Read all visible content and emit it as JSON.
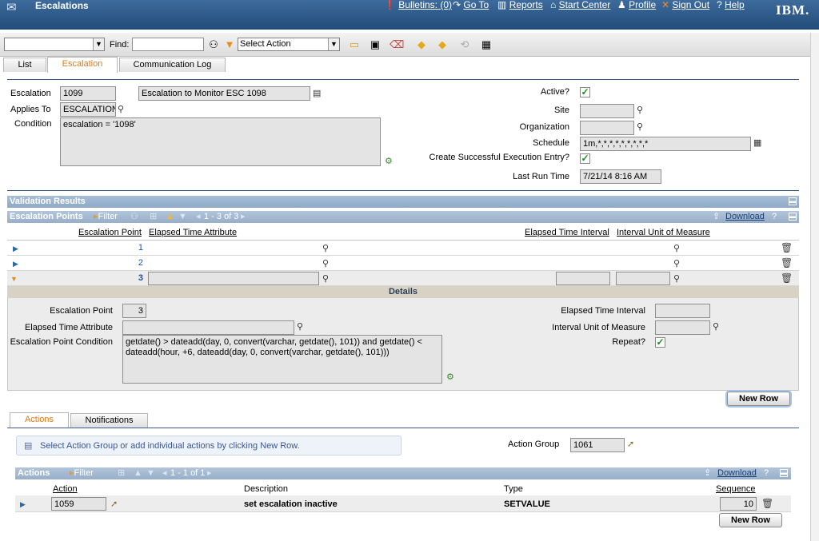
{
  "app": {
    "title": "Escalations",
    "nav": {
      "bulletins": "Bulletins: (0)",
      "goto": "Go To",
      "reports": "Reports",
      "start_center": "Start Center",
      "profile": "Profile",
      "sign_out": "Sign Out",
      "help": "Help"
    },
    "brand": "IBM."
  },
  "toolbar": {
    "find_label": "Find:",
    "find_value": "",
    "query_value": "",
    "select_action": "Select Action"
  },
  "tabs": [
    "List",
    "Escalation",
    "Communication Log"
  ],
  "header": {
    "escalation_label": "Escalation",
    "escalation_value": "1099",
    "escalation_desc": "Escalation to Monitor ESC 1098",
    "applies_to_label": "Applies To",
    "applies_to_value": "ESCALATION",
    "condition_label": "Condition",
    "condition_value": "escalation = '1098'",
    "active_label": "Active?",
    "site_label": "Site",
    "organization_label": "Organization",
    "schedule_label": "Schedule",
    "schedule_value": "1m,*,*,*,*,*,*,*,*,*",
    "create_entry_label": "Create Successful Execution Entry?",
    "last_run_label": "Last Run Time",
    "last_run_value": "7/21/14 8:16 AM"
  },
  "validation": {
    "title": "Validation Results"
  },
  "escalation_points": {
    "title": "Escalation Points",
    "filter": "Filter",
    "paging": "1 - 3 of 3",
    "download": "Download",
    "help": "?",
    "columns": [
      "Escalation Point",
      "Elapsed Time Attribute",
      "Elapsed Time Interval",
      "Interval Unit of Measure"
    ],
    "rows": [
      "1",
      "2",
      "3"
    ]
  },
  "details": {
    "title": "Details",
    "point_label": "Escalation Point",
    "point_value": "3",
    "elapsed_attr_label": "Elapsed Time Attribute",
    "condition_label": "Escalation Point Condition",
    "condition_value": "getdate() > dateadd(day, 0, convert(varchar, getdate(), 101)) and getdate() < dateadd(hour, +6, dateadd(day, 0, convert(varchar, getdate(), 101)))",
    "elapsed_interval_label": "Elapsed Time Interval",
    "interval_uom_label": "Interval Unit of Measure",
    "repeat_label": "Repeat?",
    "new_row": "New Row"
  },
  "subtabs": [
    "Actions",
    "Notifications"
  ],
  "actions_panel": {
    "hint": "Select Action Group or add individual actions by clicking New Row.",
    "group_label": "Action Group",
    "group_value": "1061"
  },
  "actions_table": {
    "title": "Actions",
    "filter": "Filter",
    "paging": "1 - 1 of 1",
    "download": "Download",
    "help": "?",
    "columns": [
      "Action",
      "Description",
      "Type",
      "Sequence"
    ],
    "rows": [
      {
        "action": "1059",
        "description": "set escalation inactive",
        "type": "SETVALUE",
        "sequence": "10"
      }
    ],
    "new_row": "New Row"
  }
}
